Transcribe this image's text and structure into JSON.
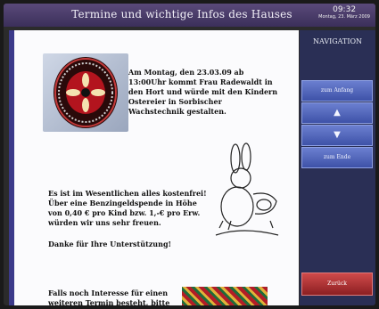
{
  "header": {
    "title": "Termine und wichtige Infos des Hauses",
    "time": "09:32",
    "date": "Montag, 23. März 2009"
  },
  "content": {
    "paragraph1": "Am Montag, den 23.03.09 ab 13:00Uhr kommt Frau Radewaldt in den Hort und würde mit den Kindern Ostereier in Sorbischer Wachstechnik gestalten.",
    "paragraph2": "Es ist im Wesentlichen alles kostenfrei! Über eine Benzingeldspende in Höhe von 0,40 € pro Kind bzw. 1,-€ pro Erw. würden wir uns sehr freuen.",
    "paragraph3": "Danke für Ihre Unterstützung!",
    "paragraph4": "Falls noch Interesse für einen weiteren Termin besteht, bitte bei Frau Fricke melden !"
  },
  "sidebar": {
    "heading": "NAVIGATION",
    "to_start": "zum Anfang",
    "up": "▲",
    "down": "▼",
    "to_end": "zum Ende",
    "back": "Zurück"
  }
}
